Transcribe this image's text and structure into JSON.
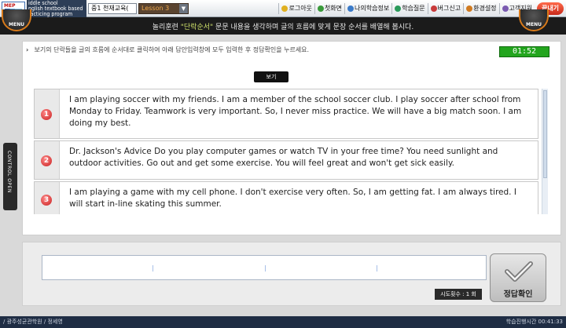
{
  "topbar": {
    "logo_text": "MEP",
    "app_title_lines": [
      "iddle school",
      "nglish textbook based",
      "racticing program"
    ],
    "publisher_select": "중1 천재교육(",
    "lesson_select": "Lesson 3",
    "nav_links": [
      {
        "label": "로그아웃",
        "icon": "logout-icon",
        "color": "#e0b020"
      },
      {
        "label": "첫화면",
        "icon": "home-icon",
        "color": "#3a9a3a"
      },
      {
        "label": "나의학습정보",
        "icon": "info-icon",
        "color": "#3a7ac8"
      },
      {
        "label": "학습질문",
        "icon": "question-icon",
        "color": "#2a9a5a"
      },
      {
        "label": "버그신고",
        "icon": "bug-icon",
        "color": "#c83a3a"
      },
      {
        "label": "환경설정",
        "icon": "settings-icon",
        "color": "#d07a20"
      },
      {
        "label": "고객지원",
        "icon": "support-icon",
        "color": "#7a5ab0"
      }
    ],
    "exit_label": "끝내기"
  },
  "instruction": {
    "before": "놀리훈련 ",
    "highlight": "\"단락순서\"",
    "after": " 문문 내용을 생각하며 글의 흐름에 맞게 문장 순서를 배열해 봅시다.",
    "menu_label": "MENU"
  },
  "main": {
    "prompt": "보기의 단락들을 글의 흐름에 순서대로 클릭하여 아래 답안입력창에 모두 입력한 후 정답확인을 누르세요.",
    "timer": "01:52",
    "view_button": "보기",
    "items": [
      {
        "num": "1",
        "text": "I am playing soccer with my friends. I am a member of the school soccer club. I play soccer after school from Monday to Friday. Teamwork is very important. So, I never miss practice. We will have a big match soon. I am doing my best."
      },
      {
        "num": "2",
        "text": "Dr. Jackson's Advice Do you play computer games or watch TV in your free time? You need sunlight and outdoor activities. Go out and get some exercise. You will feel great and won't get sick easily."
      },
      {
        "num": "3",
        "text": "I am playing a game with my cell phone. I don't exercise very often. So, I am getting fat. I am always tired. I will start in-line skating this summer."
      }
    ]
  },
  "control_tab": "CONTROL OPEN",
  "answer": {
    "attempts_label": "시도횟수 : 1 회",
    "check_label": "정답확인"
  },
  "status": {
    "left": "/ 광주성균관학원 / 정세영",
    "right": "학습진행시간 00:41:33"
  }
}
